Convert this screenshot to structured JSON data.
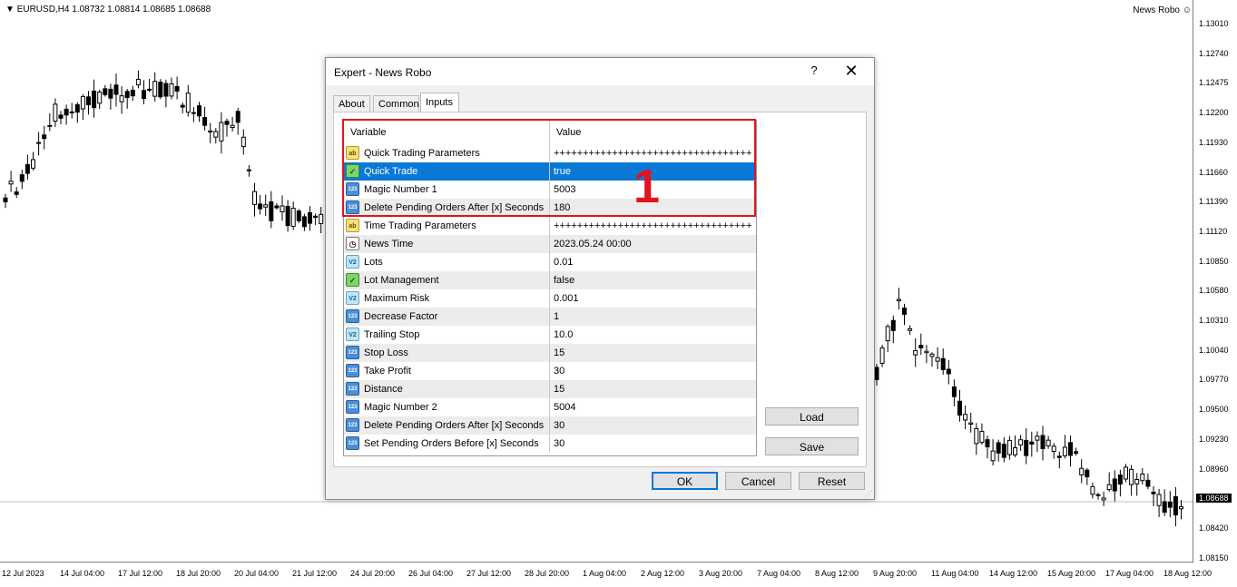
{
  "chart": {
    "symbol_info": "EURUSD,H4  1.08732 1.08814 1.08685 1.08688",
    "ea_label": "News Robo",
    "price_labels": [
      "1.13010",
      "1.12740",
      "1.12475",
      "1.12200",
      "1.11930",
      "1.11660",
      "1.11390",
      "1.11120",
      "1.10850",
      "1.10580",
      "1.10310",
      "1.10040",
      "1.09770",
      "1.09500",
      "1.09230",
      "1.08960",
      "1.08688",
      "1.08420",
      "1.08150"
    ],
    "current_price": "1.08688",
    "time_labels": [
      "12 Jul 2023",
      "14 Jul 04:00",
      "17 Jul 12:00",
      "18 Jul 20:00",
      "20 Jul 04:00",
      "21 Jul 12:00",
      "24 Jul 20:00",
      "26 Jul 04:00",
      "27 Jul 12:00",
      "28 Jul 20:00",
      "1 Aug 04:00",
      "2 Aug 12:00",
      "3 Aug 20:00",
      "7 Aug 04:00",
      "8 Aug 12:00",
      "9 Aug 20:00",
      "11 Aug 04:00",
      "14 Aug 12:00",
      "15 Aug 20:00",
      "17 Aug 04:00",
      "18 Aug 12:00"
    ],
    "colors": {
      "bull": "#ffffff",
      "bear": "#000000",
      "grid_line": "#c0c0c0"
    }
  },
  "dialog": {
    "title": "Expert - News Robo",
    "help_label": "?",
    "close_label": "✕",
    "tabs": [
      {
        "label": "About"
      },
      {
        "label": "Common"
      },
      {
        "label": "Inputs"
      }
    ],
    "active_tab": "Inputs",
    "grid": {
      "col_variable": "Variable",
      "col_value": "Value",
      "rows": [
        {
          "icon": "ab",
          "variable": "Quick Trading Parameters",
          "value": "++++++++++++++++++++++++++++++++++"
        },
        {
          "icon": "bool",
          "variable": "Quick Trade",
          "value": "true",
          "selected": true
        },
        {
          "icon": "123",
          "variable": "Magic Number 1",
          "value": "5003"
        },
        {
          "icon": "123",
          "variable": "Delete Pending Orders After [x] Seconds",
          "value": "180"
        },
        {
          "icon": "ab",
          "variable": "Time Trading Parameters",
          "value": "++++++++++++++++++++++++++++++++++"
        },
        {
          "icon": "dt",
          "variable": "News Time",
          "value": "2023.05.24 00:00"
        },
        {
          "icon": "dbl",
          "variable": "Lots",
          "value": "0.01"
        },
        {
          "icon": "bool",
          "variable": "Lot Management",
          "value": "false"
        },
        {
          "icon": "dbl",
          "variable": "Maximum Risk",
          "value": "0.001"
        },
        {
          "icon": "123",
          "variable": "Decrease Factor",
          "value": "1"
        },
        {
          "icon": "dbl",
          "variable": "Trailing Stop",
          "value": "10.0"
        },
        {
          "icon": "123",
          "variable": "Stop Loss",
          "value": "15"
        },
        {
          "icon": "123",
          "variable": "Take Profit",
          "value": "30"
        },
        {
          "icon": "123",
          "variable": "Distance",
          "value": "15"
        },
        {
          "icon": "123",
          "variable": "Magic Number 2",
          "value": "5004"
        },
        {
          "icon": "123",
          "variable": "Delete Pending Orders After [x] Seconds",
          "value": "30"
        },
        {
          "icon": "123",
          "variable": "Set Pending Orders Before [x] Seconds",
          "value": "30"
        }
      ]
    },
    "icon_text": {
      "ab": "ab",
      "123": "123",
      "bool": "✓",
      "dbl": "V2",
      "dt": "◷"
    },
    "load_label": "Load",
    "save_label": "Save",
    "ok_label": "OK",
    "cancel_label": "Cancel",
    "reset_label": "Reset",
    "selection_color": "#0a79d6"
  },
  "annotation": {
    "number": "1",
    "color": "#e1141e"
  }
}
